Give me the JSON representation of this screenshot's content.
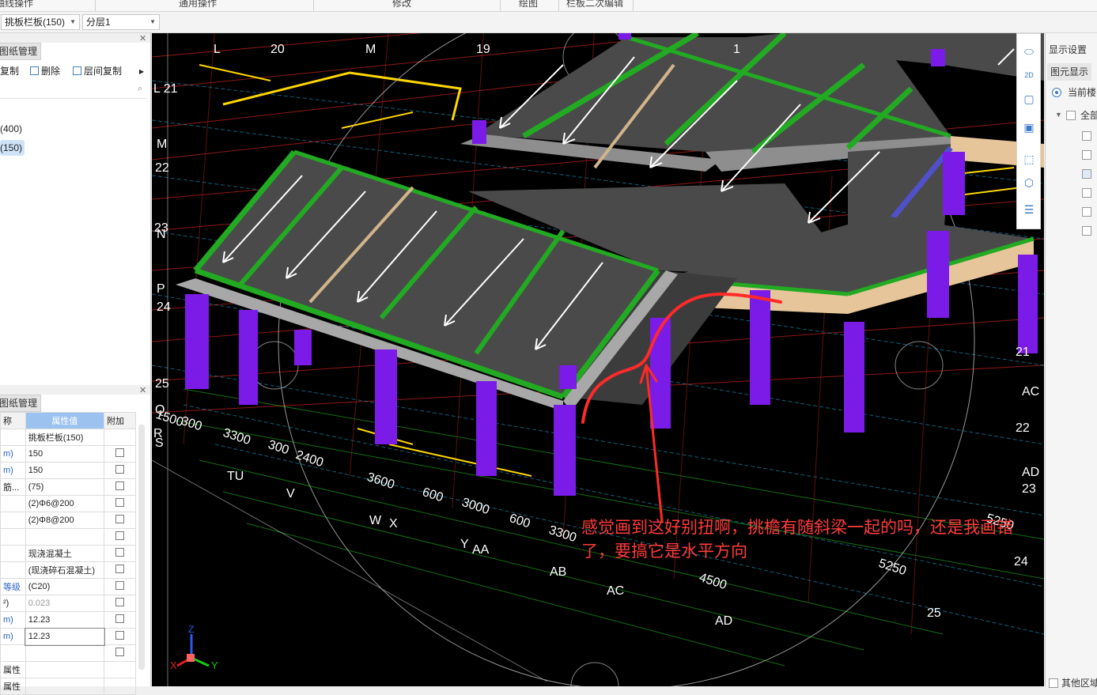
{
  "ribbon": {
    "tabs": [
      "轴线操作",
      "通用操作",
      "修改",
      "绘图",
      "栏板二次编辑"
    ]
  },
  "selectors": {
    "component": "挑板栏板(150)",
    "layer": "分层1"
  },
  "left_panel": {
    "drawing_tab": "图纸管理",
    "toolbar": {
      "copy": "复制",
      "delete": "删除",
      "floor_copy": "层间复制",
      "more": "▸"
    },
    "tree": [
      {
        "label": "(400)",
        "selected": false
      },
      {
        "label": "(150)",
        "selected": true
      }
    ],
    "props_tab": "图纸管理",
    "props_header": {
      "name": "称",
      "value": "属性值",
      "extra": "附加"
    },
    "props_rows": [
      {
        "name": "",
        "value": "挑板栏板(150)",
        "style": "normal",
        "has_check": false
      },
      {
        "name": "m)",
        "value": "150",
        "style": "blue",
        "has_check": true
      },
      {
        "name": "m)",
        "value": "150",
        "style": "blue",
        "has_check": true
      },
      {
        "name": "筋...",
        "value": "(75)",
        "style": "normal",
        "has_check": true
      },
      {
        "name": "",
        "value": "(2)Φ6@200",
        "style": "normal",
        "has_check": true
      },
      {
        "name": "",
        "value": "(2)Φ8@200",
        "style": "normal",
        "has_check": true
      },
      {
        "name": "",
        "value": "",
        "style": "normal",
        "has_check": true
      },
      {
        "name": "",
        "value": "现浇混凝土",
        "style": "normal",
        "has_check": true
      },
      {
        "name": "",
        "value": "(现浇碎石混凝土)",
        "style": "normal",
        "has_check": true
      },
      {
        "name": "等级",
        "value": "(C20)",
        "style": "blue",
        "has_check": true
      },
      {
        "name": "²)",
        "value": "0.023",
        "style": "gray",
        "has_check": true
      },
      {
        "name": "m)",
        "value": "12.23",
        "style": "blue",
        "has_check": true
      },
      {
        "name": "m)",
        "value": "12.23",
        "style": "blue",
        "has_check": true
      },
      {
        "name": "",
        "value": "",
        "style": "normal",
        "has_check": true
      },
      {
        "name": "属性",
        "value": "",
        "style": "normal",
        "has_check": false
      },
      {
        "name": "属性",
        "value": "",
        "style": "normal",
        "has_check": false
      }
    ]
  },
  "viewport": {
    "grid_labels": [
      "L",
      "20",
      "M",
      "19",
      "1",
      "L 21",
      "M",
      "22",
      "23",
      "N",
      "P",
      "24",
      "25",
      "Q",
      "R",
      "S",
      "TU",
      "V",
      "W",
      "X",
      "Y",
      "AA",
      "AB",
      "AC",
      "AD",
      "AC",
      "22",
      "AD",
      "23",
      "24",
      "25",
      "21"
    ],
    "dimensions": [
      "1500",
      "300",
      "3300",
      "300",
      "2400",
      "3600",
      "600",
      "3000",
      "600",
      "3300",
      "4500",
      "5250",
      "5250"
    ],
    "annotation": "感觉画到这好别扭啊，挑檐有随斜梁一起的吗，还是我画错了，要搞它是水平方向",
    "axis": {
      "x": "X",
      "y": "Y",
      "z": "Z"
    },
    "colors": {
      "background": "#000000",
      "column": "#7a1be8",
      "beam": "#22aa22",
      "slab": "#4a4a4a",
      "railing": "#a8a8a8",
      "annotation": "#ff3030"
    }
  },
  "view_tools": [
    "3d-orbit-icon",
    "2d-icon",
    "cube-icon",
    "cube-solid-icon",
    "frame-icon",
    "box-select-icon",
    "settings-list-icon"
  ],
  "right_panel": {
    "display_settings": "显示设置",
    "element_display": "图元显示",
    "current_floor": "当前楼",
    "all": "全部",
    "bottom": "其他区域"
  }
}
